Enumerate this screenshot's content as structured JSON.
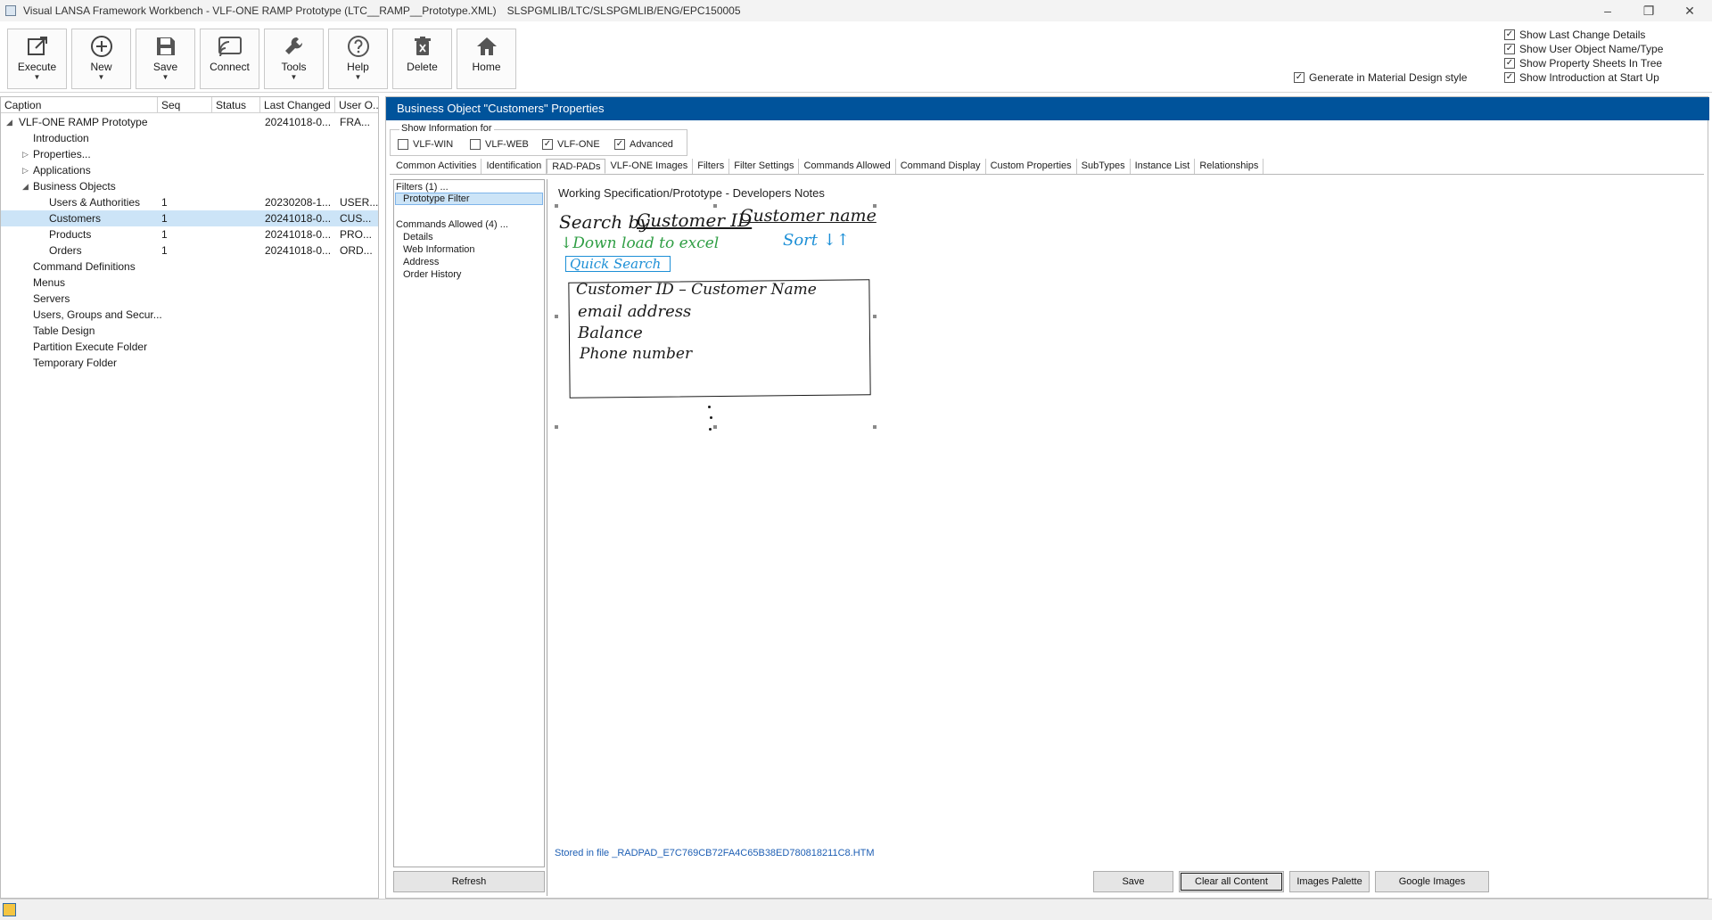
{
  "window": {
    "title": "Visual LANSA Framework Workbench - VLF-ONE RAMP Prototype (LTC__RAMP__Prototype.XML)",
    "path": "SLSPGMLIB/LTC/SLSPGMLIB/ENG/EPC150005"
  },
  "toolbar": {
    "execute": "Execute",
    "new": "New",
    "save": "Save",
    "connect": "Connect",
    "tools": "Tools",
    "help": "Help",
    "delete": "Delete",
    "home": "Home"
  },
  "options": {
    "material_design": "Generate in Material Design style",
    "last_change": "Show Last Change Details",
    "user_object": "Show User Object Name/Type",
    "property_sheets": "Show Property Sheets In Tree",
    "introduction": "Show Introduction at Start Up"
  },
  "tree": {
    "columns": [
      "Caption",
      "Seq",
      "Status",
      "Last Changed",
      "User O..."
    ],
    "rows": [
      {
        "caption": "VLF-ONE RAMP Prototype",
        "expander": "◢",
        "seq": "",
        "changed": "20241018-0...",
        "user": "FRA..."
      },
      {
        "caption": "Introduction",
        "expander": "",
        "seq": "",
        "changed": "",
        "user": ""
      },
      {
        "caption": "Properties...",
        "expander": "▷",
        "seq": "",
        "changed": "",
        "user": ""
      },
      {
        "caption": "Applications",
        "expander": "▷",
        "seq": "",
        "changed": "",
        "user": ""
      },
      {
        "caption": "Business Objects",
        "expander": "◢",
        "seq": "",
        "changed": "",
        "user": ""
      },
      {
        "caption": "Users & Authorities",
        "expander": "",
        "seq": "1",
        "changed": "20230208-1...",
        "user": "USER..."
      },
      {
        "caption": "Customers",
        "expander": "",
        "seq": "1",
        "changed": "20241018-0...",
        "user": "CUS..."
      },
      {
        "caption": "Products",
        "expander": "",
        "seq": "1",
        "changed": "20241018-0...",
        "user": "PRO..."
      },
      {
        "caption": "Orders",
        "expander": "",
        "seq": "1",
        "changed": "20241018-0...",
        "user": "ORD..."
      },
      {
        "caption": "Command Definitions",
        "expander": "",
        "seq": "",
        "changed": "",
        "user": ""
      },
      {
        "caption": "Menus",
        "expander": "",
        "seq": "",
        "changed": "",
        "user": ""
      },
      {
        "caption": "Servers",
        "expander": "",
        "seq": "",
        "changed": "",
        "user": ""
      },
      {
        "caption": "Users, Groups and Secur...",
        "expander": "",
        "seq": "",
        "changed": "",
        "user": ""
      },
      {
        "caption": "Table Design",
        "expander": "",
        "seq": "",
        "changed": "",
        "user": ""
      },
      {
        "caption": "Partition Execute Folder",
        "expander": "",
        "seq": "",
        "changed": "",
        "user": ""
      },
      {
        "caption": "Temporary Folder",
        "expander": "",
        "seq": "",
        "changed": "",
        "user": ""
      }
    ],
    "selected_index": 6
  },
  "properties": {
    "header": "Business Object \"Customers\" Properties",
    "show_info_legend": "Show Information for",
    "show_info": [
      {
        "label": "VLF-WIN",
        "checked": false
      },
      {
        "label": "VLF-WEB",
        "checked": false
      },
      {
        "label": "VLF-ONE",
        "checked": true
      },
      {
        "label": "Advanced",
        "checked": true
      }
    ],
    "tabs": [
      "Common Activities",
      "Identification",
      "RAD-PADs",
      "VLF-ONE Images",
      "Filters",
      "Filter Settings",
      "Commands Allowed",
      "Command Display",
      "Custom Properties",
      "SubTypes",
      "Instance List",
      "Relationships"
    ],
    "active_tab": "RAD-PADs"
  },
  "radpad": {
    "filters_heading": "Filters (1) ...",
    "filter_items": [
      "Prototype Filter"
    ],
    "commands_heading": "Commands Allowed (4) ...",
    "command_items": [
      "Details",
      "Web Information",
      "Address",
      "Order History"
    ],
    "refresh": "Refresh",
    "notes_title": "Working Specification/Prototype - Developers Notes",
    "stored_file": "Stored in file _RADPAD_E7C769CB72FA4C65B38ED780818211C8.HTM",
    "buttons": {
      "save": "Save",
      "clear": "Clear all Content",
      "images_palette": "Images Palette",
      "google_images": "Google Images"
    },
    "sketch": {
      "search_by": "Search by",
      "customer_id": "Customer ID",
      "customer_name": "Customer name",
      "download": "↓Down load to excel",
      "sort": "Sort ↓↑",
      "quick_search": "Quick Search",
      "list_lines": [
        "Customer ID – Customer Name",
        "email address",
        "Balance",
        "Phone number"
      ],
      "colors": {
        "ink": "#1a1a1a",
        "green": "#2f9e44",
        "blue": "#1c8fd6"
      }
    }
  }
}
